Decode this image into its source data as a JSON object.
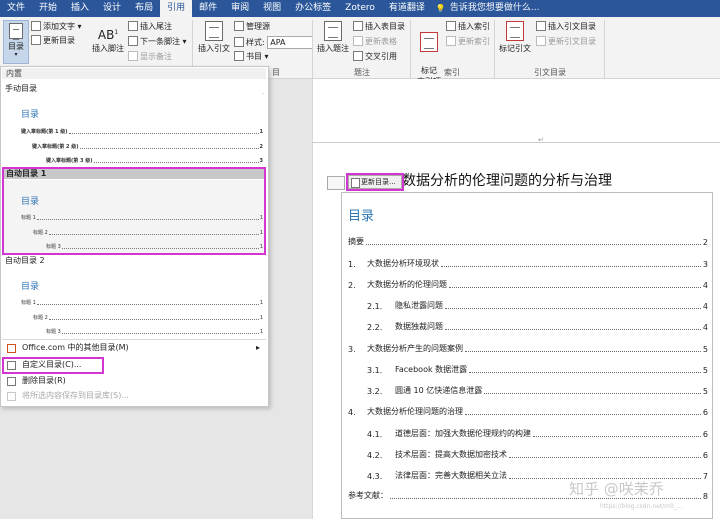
{
  "tabs": [
    "文件",
    "开始",
    "插入",
    "设计",
    "布局",
    "引用",
    "邮件",
    "审阅",
    "视图",
    "办公标签",
    "Zotero",
    "有道翻译",
    "告诉我您想要做什么..."
  ],
  "active_tab": "引用",
  "ribbon": {
    "toc_button": "目录",
    "add_text": "添加文字",
    "update_toc": "更新目录",
    "insert_footnote": "插入脚注",
    "insert_endnote": "插入尾注",
    "next_footnote": "下一条脚注",
    "show_notes": "显示备注",
    "insert_citation": "插入引文",
    "manage_sources": "管理源",
    "style_label": "样式:",
    "style_value": "APA",
    "bibliography": "书目",
    "insert_caption": "插入题注",
    "insert_table_of_figures": "插入表目录",
    "update_table": "更新表格",
    "cross_reference": "交叉引用",
    "mark_entry": "标记\n索引项",
    "insert_index": "插入索引",
    "update_index": "更新索引",
    "mark_citation": "标记引文",
    "insert_table_of_authorities": "插入引文目录",
    "update_table_authorities": "更新引文目录",
    "group_captions": "题注",
    "group_index": "索引",
    "group_authorities": "引文目录",
    "group_citations_partial": "目"
  },
  "panel": {
    "builtin_header": "内置",
    "manual_toc": "手动目录",
    "manual_preview": {
      "title": "目录",
      "lines": [
        {
          "text": "键入章标题(第 1 级)",
          "page": "1"
        },
        {
          "text": "键入章标题(第 2 级)",
          "page": "2"
        },
        {
          "text": "键入章标题(第 3 级)",
          "page": "3"
        }
      ]
    },
    "auto_toc_1": "自动目录 1",
    "auto1_preview": {
      "title": "目录",
      "lines": [
        {
          "text": "标题 1",
          "page": "1"
        },
        {
          "text": "标题 2",
          "page": "1"
        },
        {
          "text": "标题 3",
          "page": "1"
        }
      ]
    },
    "auto_toc_2": "自动目录 2",
    "auto2_preview": {
      "title": "目录",
      "lines": [
        {
          "text": "标题 1",
          "page": "1"
        },
        {
          "text": "标题 2",
          "page": "1"
        },
        {
          "text": "标题 3",
          "page": "1"
        }
      ]
    },
    "menu": {
      "office_more": "Office.com 中的其他目录(M)",
      "custom_toc": "自定义目录(C)...",
      "remove_toc": "删除目录(R)",
      "save_selection": "将所选内容保存到目录库(S)..."
    }
  },
  "document": {
    "title": "大数据分析的伦理问题的分析与治理",
    "update_toc_control": "更新目录...",
    "toc_heading": "目录",
    "entries": [
      {
        "num": "",
        "text": "摘要",
        "page": "2"
      },
      {
        "num": "1.",
        "text": "大数据分析环境现状",
        "page": "3"
      },
      {
        "num": "2.",
        "text": "大数据分析的伦理问题",
        "page": "4"
      },
      {
        "num": "2.1.",
        "text": "隐私泄露问题",
        "page": "4"
      },
      {
        "num": "2.2.",
        "text": "数据独裁问题",
        "page": "4"
      },
      {
        "num": "3.",
        "text": "大数据分析产生的问题案例",
        "page": "5"
      },
      {
        "num": "3.1.",
        "text": "Facebook 数据泄露",
        "page": "5"
      },
      {
        "num": "3.2.",
        "text": "圆通 10 亿快递信息泄露",
        "page": "5"
      },
      {
        "num": "4.",
        "text": "大数据分析伦理问题的治理",
        "page": "6"
      },
      {
        "num": "4.1.",
        "text": "道德层面：加强大数据伦理规约的构建",
        "page": "6"
      },
      {
        "num": "4.2.",
        "text": "技术层面：提高大数据加密技术",
        "page": "6"
      },
      {
        "num": "4.3.",
        "text": "法律层面：完善大数据相关立法",
        "page": "7"
      },
      {
        "num": "",
        "text": "参考文献：",
        "page": "8"
      }
    ]
  },
  "watermark": {
    "main": "知乎 @咲茉乔",
    "small": "https://blog.csdn.net/m0_..."
  }
}
